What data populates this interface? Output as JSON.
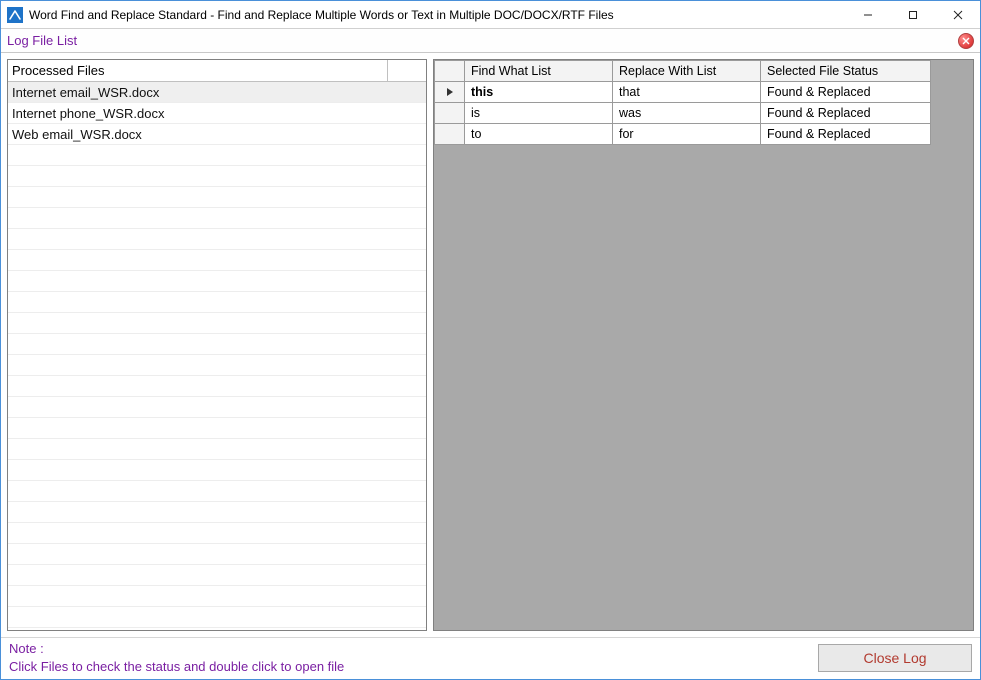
{
  "window": {
    "title": "Word Find and Replace Standard  - Find and Replace Multiple Words or Text  in Multiple DOC/DOCX/RTF Files"
  },
  "section": {
    "title": "Log File List"
  },
  "files": {
    "header": "Processed Files",
    "items": [
      {
        "name": "Internet email_WSR.docx",
        "selected": true
      },
      {
        "name": "Internet phone_WSR.docx",
        "selected": false
      },
      {
        "name": "Web email_WSR.docx",
        "selected": false
      }
    ],
    "empty_row_count": 24
  },
  "grid": {
    "columns": {
      "find": "Find What List",
      "replace": "Replace With List",
      "status": "Selected File Status"
    },
    "rows": [
      {
        "find": "this",
        "replace": "that",
        "status": "Found & Replaced",
        "current": true
      },
      {
        "find": "is",
        "replace": "was",
        "status": "Found & Replaced",
        "current": false
      },
      {
        "find": "to",
        "replace": "for",
        "status": "Found & Replaced",
        "current": false
      }
    ]
  },
  "footer": {
    "note_label": "Note :",
    "note_text": "Click Files to check the status and double click to open file",
    "close_button": "Close Log"
  }
}
